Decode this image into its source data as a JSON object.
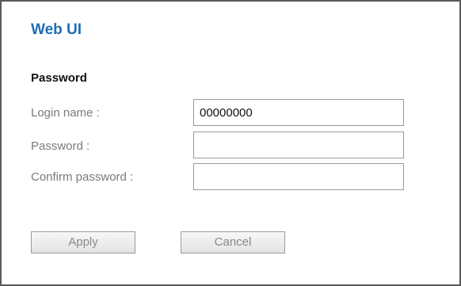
{
  "app": {
    "title": "Web UI"
  },
  "password_section": {
    "heading": "Password",
    "login_name": {
      "label": "Login name :",
      "value": "00000000"
    },
    "password": {
      "label": "Password :",
      "value": ""
    },
    "confirm_password": {
      "label": "Confirm password :",
      "value": ""
    }
  },
  "actions": {
    "apply_label": "Apply",
    "cancel_label": "Cancel"
  }
}
